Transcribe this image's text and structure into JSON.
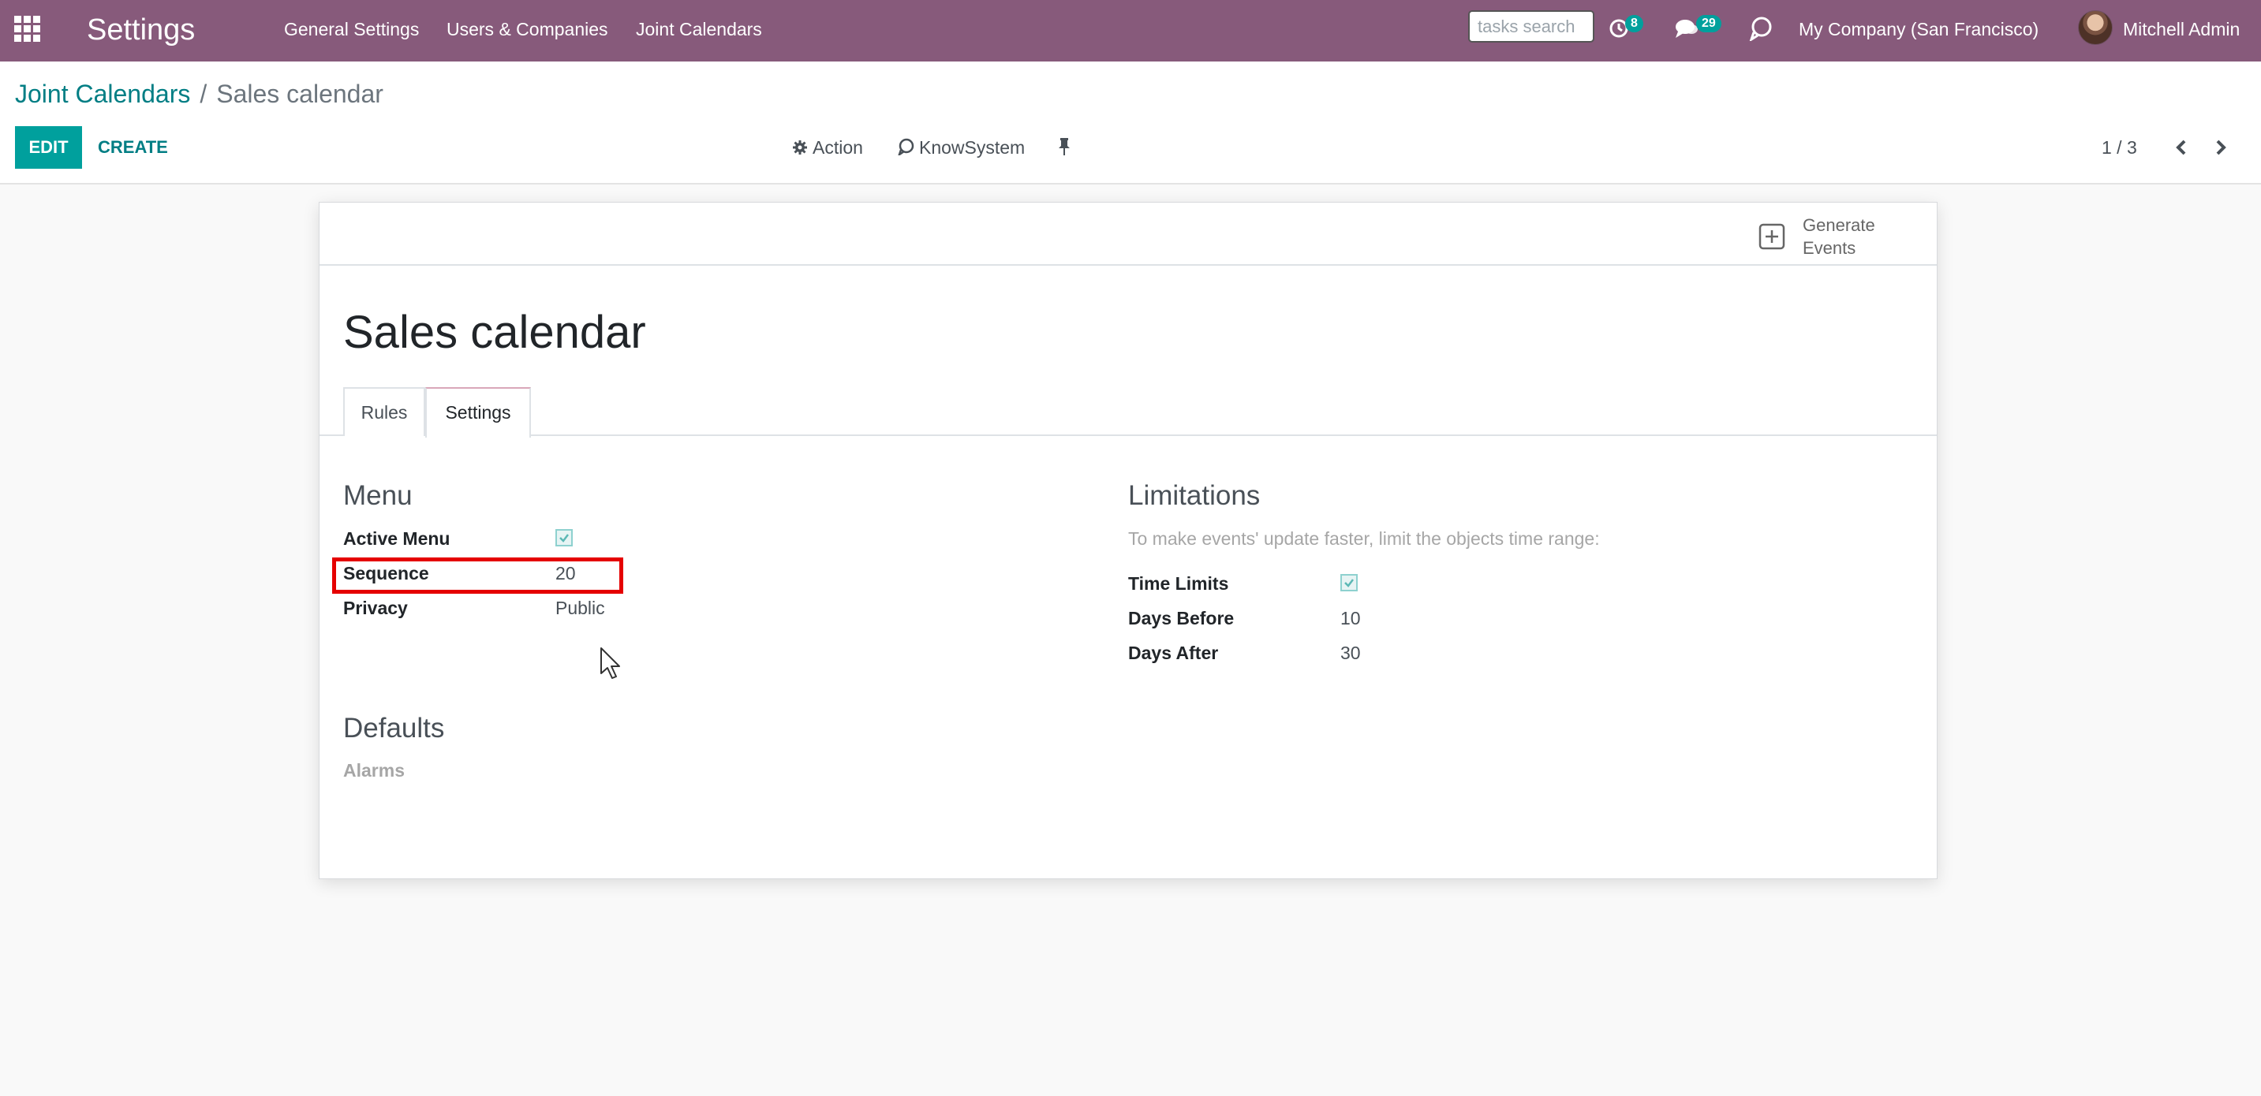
{
  "navbar": {
    "brand": "Settings",
    "menu_items": [
      "General Settings",
      "Users & Companies",
      "Joint Calendars"
    ],
    "search_placeholder": "tasks search",
    "activity_count": "8",
    "messages_count": "29",
    "company": "My Company (San Francisco)",
    "user": "Mitchell Admin"
  },
  "breadcrumb": {
    "parent": "Joint Calendars",
    "separator": "/",
    "current": "Sales calendar"
  },
  "control_panel": {
    "edit_label": "EDIT",
    "create_label": "CREATE",
    "action_label": "Action",
    "knowsystem_label": "KnowSystem",
    "pager": "1 / 3"
  },
  "button_box": {
    "generate_events": "Generate Events"
  },
  "record": {
    "title": "Sales calendar"
  },
  "tabs": [
    {
      "label": "Rules",
      "active": false
    },
    {
      "label": "Settings",
      "active": true
    }
  ],
  "menu_section": {
    "title": "Menu",
    "fields": [
      {
        "label": "Active Menu",
        "value": true
      },
      {
        "label": "Sequence",
        "value": "20"
      },
      {
        "label": "Privacy",
        "value": "Public"
      }
    ]
  },
  "limitations_section": {
    "title": "Limitations",
    "help": "To make events' update faster, limit the objects time range:",
    "fields": [
      {
        "label": "Time Limits",
        "value": true
      },
      {
        "label": "Days Before",
        "value": "10"
      },
      {
        "label": "Days After",
        "value": "30"
      }
    ]
  },
  "defaults_section": {
    "title": "Defaults",
    "alarms_label": "Alarms"
  },
  "colors": {
    "navbar": "#875a7b",
    "primary": "#00a09d",
    "link": "#017e84",
    "highlight": "#e50000"
  }
}
